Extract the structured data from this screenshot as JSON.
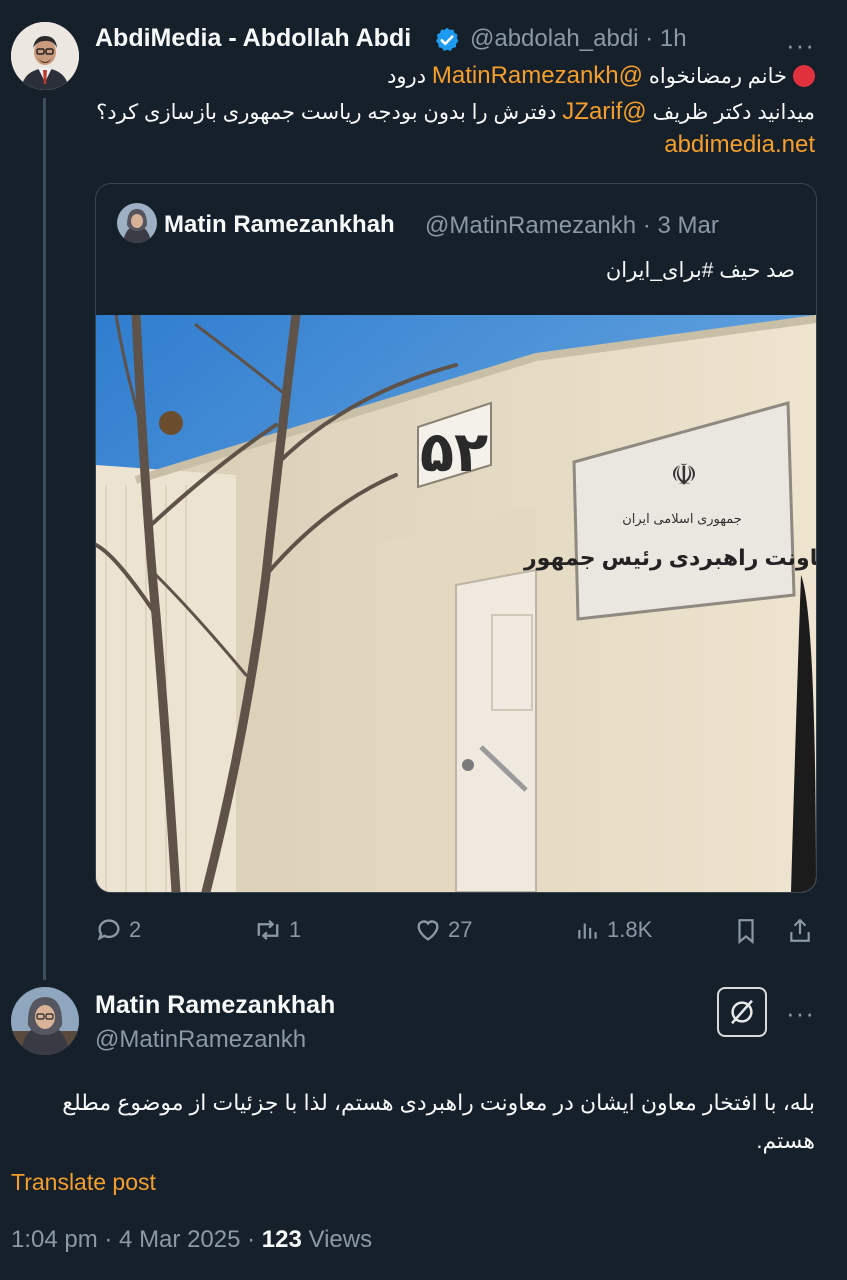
{
  "tweet": {
    "author_name": "AbdiMedia - Abdollah Abdi",
    "handle": "@abdolah_abdi",
    "time": "· 1h",
    "more": "···",
    "line1_greeting": "درود",
    "line1_mention": "@MatinRamezankh",
    "line1_text": "خانم رمضانخواه",
    "line2_prefix": "میدانید دکتر ظریف",
    "line2_mention": "@JZarif",
    "line2_suffix": "دفترش را بدون بودجه ریاست جمهوری بازسازی کرد؟",
    "link": "abdimedia.net"
  },
  "quote": {
    "author_name": "Matin Ramezankhah",
    "handle": "@MatinRamezankh",
    "time": "· 3 Mar",
    "text": "صد حیف #برای_ایران",
    "image": {
      "plaque_number": "۵۲",
      "sign_line1": "جمهوری اسلامی ایران",
      "sign_line2": "معاونت راهبردی رئیس جمهور"
    }
  },
  "actions": {
    "replies": "2",
    "reposts": "1",
    "likes": "27",
    "views": "1.8K"
  },
  "reply": {
    "author_name": "Matin Ramezankhah",
    "handle": "@MatinRamezankh",
    "more": "···",
    "text": "بله، با افتخار معاون ایشان در معاونت راهبردی هستم، لذا با جزئیات از موضوع مطلع هستم.",
    "translate": "Translate post",
    "time": "1:04 pm · 4 Mar 2025 ·",
    "views_count": "123",
    "views_label": "Views"
  },
  "colors": {
    "background": "#15202b",
    "accent": "#f59e2b",
    "muted": "#8b98a5",
    "verified": "#1d9bf0"
  }
}
